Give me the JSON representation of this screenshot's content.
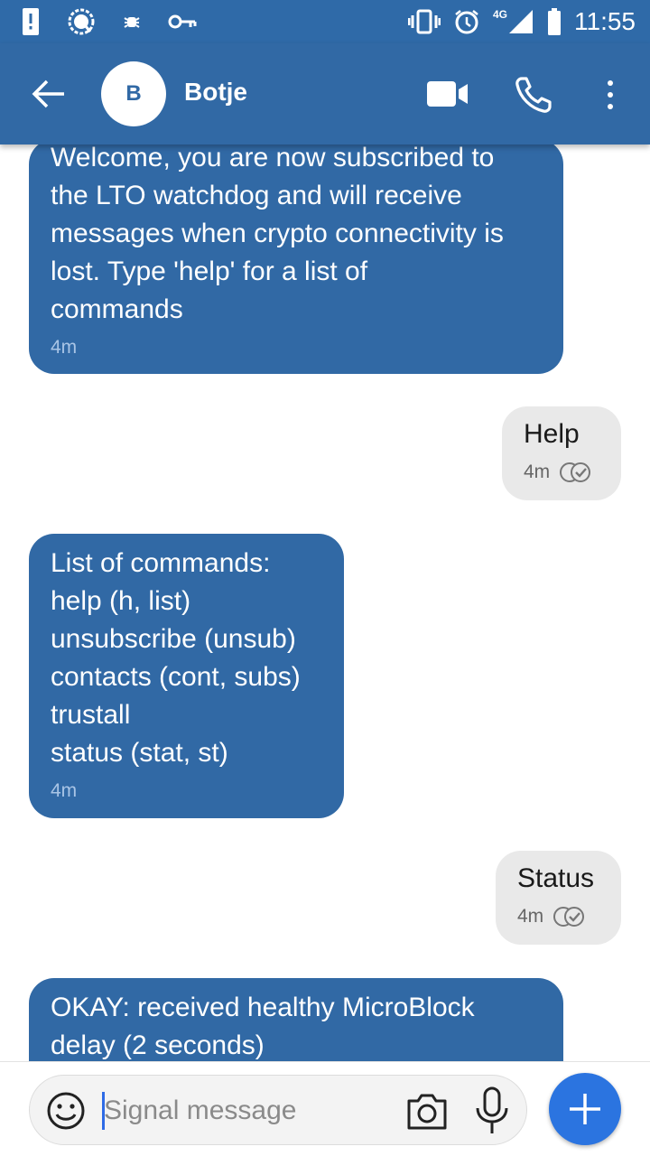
{
  "status_bar": {
    "time": "11:55",
    "network_label": "4G",
    "icons": [
      "alert-icon",
      "signal-app-icon",
      "bug-icon",
      "vpn-key-icon",
      "vibrate-icon",
      "alarm-icon",
      "cell-signal-icon",
      "battery-icon"
    ]
  },
  "header": {
    "avatar_initial": "B",
    "contact_name": "Botje",
    "icons": [
      "back-arrow-icon",
      "video-call-icon",
      "phone-call-icon",
      "more-vert-icon"
    ]
  },
  "messages": [
    {
      "direction": "incoming",
      "lines": [
        "Welcome, you are now subscribed to",
        "the LTO watchdog and will receive",
        "messages when crypto connectivity is",
        "lost. Type 'help' for a list of",
        "commands"
      ],
      "time": "4m"
    },
    {
      "direction": "outgoing",
      "lines": [
        "Help"
      ],
      "time": "4m",
      "delivery": "delivered"
    },
    {
      "direction": "incoming",
      "lines": [
        "List of commands:",
        "help (h, list)",
        "unsubscribe (unsub)",
        "contacts (cont, subs)",
        "trustall",
        "status (stat, st)"
      ],
      "time": "4m"
    },
    {
      "direction": "outgoing",
      "lines": [
        "Status"
      ],
      "time": "4m",
      "delivery": "delivered"
    },
    {
      "direction": "incoming",
      "lines": [
        "OKAY: received healthy MicroBlock",
        "delay (2 seconds)"
      ],
      "time": ""
    }
  ],
  "composer": {
    "placeholder": "Signal message",
    "icons": [
      "emoji-icon",
      "camera-icon",
      "microphone-icon",
      "plus-icon"
    ]
  },
  "colors": {
    "primary": "#3169a5",
    "status_bar": "#2f6aa8",
    "outgoing_bubble": "#e9e9e9",
    "fab": "#2b74e0"
  }
}
